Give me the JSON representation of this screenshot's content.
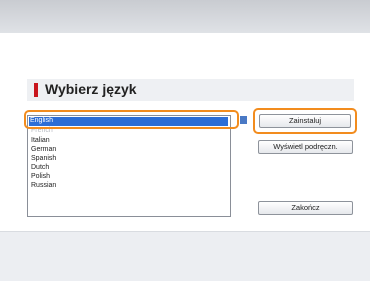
{
  "dialog": {
    "title": "Wybierz język"
  },
  "languages": [
    {
      "label": "English",
      "selected": true
    },
    {
      "label": "French",
      "faded": true
    },
    {
      "label": "Italian"
    },
    {
      "label": "German"
    },
    {
      "label": "Spanish"
    },
    {
      "label": "Dutch"
    },
    {
      "label": "Polish"
    },
    {
      "label": "Russian"
    }
  ],
  "buttons": {
    "install": "Zainstaluj",
    "show_guide": "Wyświetl podręczn.",
    "finish": "Zakończ"
  },
  "colors": {
    "highlight_ring": "#f28c1e",
    "selection": "#2d6ed6",
    "title_marker": "#c8161d"
  }
}
